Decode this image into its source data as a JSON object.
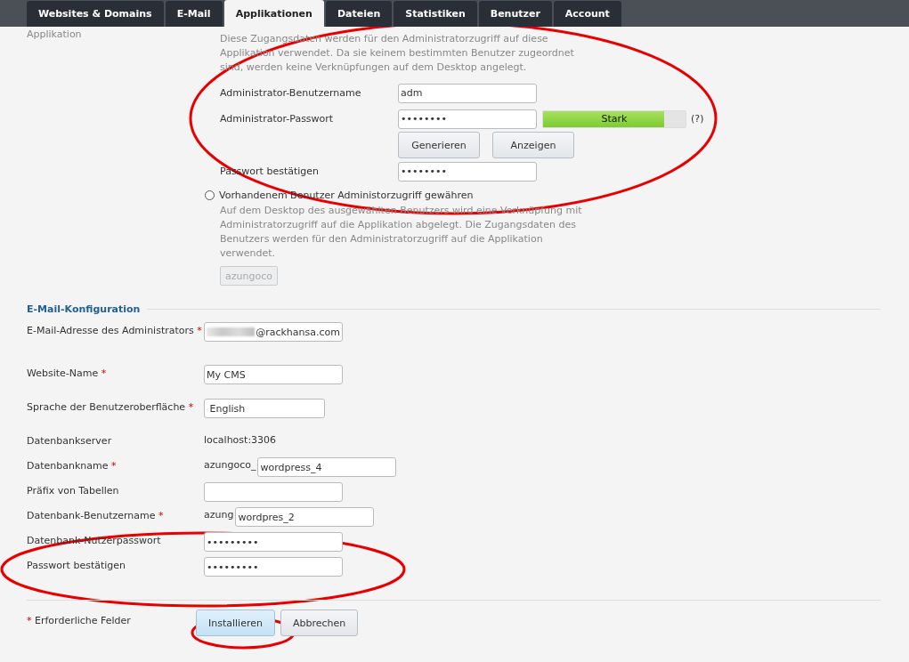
{
  "tabs": [
    {
      "label": "Websites & Domains",
      "selected": false
    },
    {
      "label": "E-Mail",
      "selected": false
    },
    {
      "label": "Applikationen",
      "selected": true
    },
    {
      "label": "Dateien",
      "selected": false
    },
    {
      "label": "Statistiken",
      "selected": false
    },
    {
      "label": "Benutzer",
      "selected": false
    },
    {
      "label": "Account",
      "selected": false
    }
  ],
  "admin_section": {
    "label": "Applikation",
    "description": "Diese Zugangsdaten werden für den Administratorzugriff auf diese Applikation verwendet. Da sie keinem bestimmten Benutzer zugeordnet sind, werden keine Verknüpfungen auf dem Desktop angelegt.",
    "username": {
      "label": "Administrator-Benutzername",
      "value": "adm"
    },
    "password": {
      "label": "Administrator-Passwort",
      "value": "••••••••",
      "strength": {
        "label": "Stark",
        "level": 0.85
      },
      "help": "(?)"
    },
    "buttons": [
      "Generieren",
      "Anzeigen"
    ],
    "confirm": {
      "label": "Passwort bestätigen",
      "value": "••••••••"
    },
    "existing_user": {
      "label": "Vorhandenem Benutzer Administorzugriff gewähren",
      "selected": false,
      "description": "Auf dem Desktop des ausgewählten Benutzers wird eine Verknüpfung mit Administratorzugriff auf die Applikation abgelegt. Die Zugangsdaten des Benutzers werden für den Administratorzugriff auf die Applikation verwendet.",
      "user": "azungoco",
      "disabled": true
    }
  },
  "config_section": {
    "title": "E-Mail-Konfiguration",
    "rows": [
      {
        "kind": "input",
        "label": "E-Mail-Adresse des Administrators",
        "mark": "*",
        "value": "@rackhansa.com",
        "blurred": true
      },
      {
        "kind": "input",
        "label": "Website-Name",
        "mark": "*",
        "value": "My CMS"
      },
      {
        "kind": "select",
        "label": "Sprache der Benutzeroberfläche",
        "mark": "*",
        "value": "English"
      },
      {
        "kind": "text",
        "label": "Datenbankserver",
        "value": "localhost:3306"
      },
      {
        "kind": "prefixed",
        "label": "Datenbankname",
        "mark": "*",
        "prefix": "azungoco_",
        "value": "wordpress_4"
      },
      {
        "kind": "input",
        "label": "Präfix von Tabellen"
      },
      {
        "kind": "prefixed",
        "label": "Datenbank-Benutzername",
        "mark": "*",
        "prefix": "azung",
        "value": "wordpres_2"
      },
      {
        "kind": "input",
        "label": "Datenbank-Nutzerpasswort",
        "value": "•••••••••"
      },
      {
        "kind": "input",
        "label": "Passwort bestätigen",
        "value": "•••••••••"
      }
    ]
  },
  "footer": {
    "mark": "*",
    "note": "Erforderliche Felder",
    "buttons": [
      {
        "label": "Installieren",
        "primary": true
      },
      {
        "label": "Abbrechen",
        "primary": false
      }
    ]
  }
}
